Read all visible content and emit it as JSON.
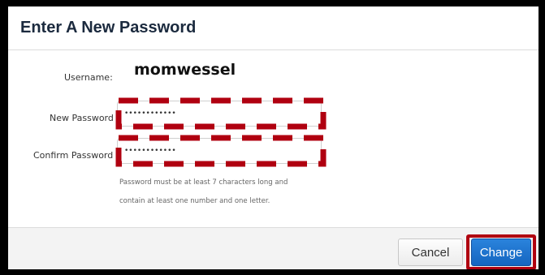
{
  "dialog": {
    "title": "Enter A New Password"
  },
  "form": {
    "username_label": "Username:",
    "username_value": "momwessel",
    "new_password_label": "New Password",
    "new_password_value": "••••••••••••",
    "confirm_password_label": "Confirm Password",
    "confirm_password_value": "••••••••••••",
    "hint_line1": "Password must be at least 7 characters long and",
    "hint_line2": "contain at least one number and one letter."
  },
  "footer": {
    "cancel_label": "Cancel",
    "change_label": "Change"
  },
  "colors": {
    "highlight": "#b00010",
    "primary_button": "#1a6fcf",
    "title_text": "#1b2a3e"
  }
}
